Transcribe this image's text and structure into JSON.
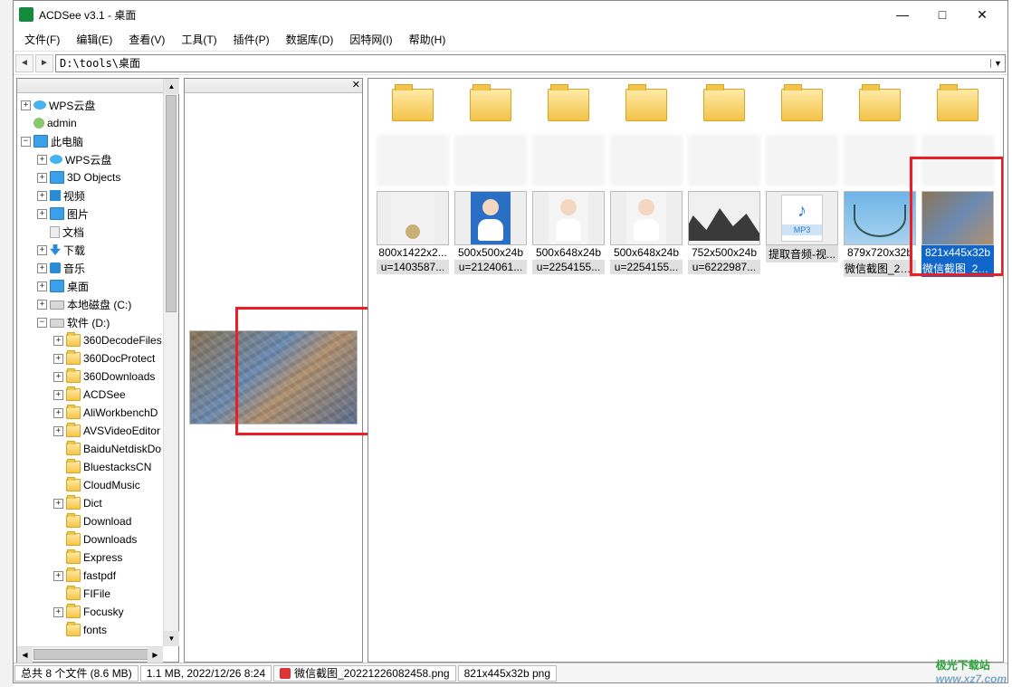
{
  "window": {
    "title": "ACDSee v3.1 - 桌面",
    "min": "—",
    "max": "□",
    "close": "✕"
  },
  "menu": [
    "文件(F)",
    "编辑(E)",
    "查看(V)",
    "工具(T)",
    "插件(P)",
    "数据库(D)",
    "因特网(I)",
    "帮助(H)"
  ],
  "address": "D:\\tools\\桌面",
  "tree": [
    {
      "d": 0,
      "exp": "+",
      "ico": "cloud",
      "label": "WPS云盘"
    },
    {
      "d": 0,
      "exp": "",
      "ico": "user",
      "label": "admin"
    },
    {
      "d": 0,
      "exp": "-",
      "ico": "computer",
      "label": "此电脑"
    },
    {
      "d": 1,
      "exp": "+",
      "ico": "cloud",
      "label": "WPS云盘"
    },
    {
      "d": 1,
      "exp": "+",
      "ico": "computer",
      "label": "3D Objects"
    },
    {
      "d": 1,
      "exp": "+",
      "ico": "video",
      "label": "视频"
    },
    {
      "d": 1,
      "exp": "+",
      "ico": "computer",
      "label": "图片"
    },
    {
      "d": 1,
      "exp": "",
      "ico": "doc",
      "label": "文档"
    },
    {
      "d": 1,
      "exp": "+",
      "ico": "dlarrow",
      "label": "下载"
    },
    {
      "d": 1,
      "exp": "+",
      "ico": "music",
      "label": "音乐"
    },
    {
      "d": 1,
      "exp": "+",
      "ico": "computer",
      "label": "桌面"
    },
    {
      "d": 1,
      "exp": "+",
      "ico": "disk",
      "label": "本地磁盘 (C:)"
    },
    {
      "d": 1,
      "exp": "-",
      "ico": "disk",
      "label": "软件 (D:)"
    },
    {
      "d": 2,
      "exp": "+",
      "ico": "folder",
      "label": "360DecodeFiles"
    },
    {
      "d": 2,
      "exp": "+",
      "ico": "folder",
      "label": "360DocProtect"
    },
    {
      "d": 2,
      "exp": "+",
      "ico": "folder",
      "label": "360Downloads"
    },
    {
      "d": 2,
      "exp": "+",
      "ico": "folder",
      "label": "ACDSee"
    },
    {
      "d": 2,
      "exp": "+",
      "ico": "folder",
      "label": "AliWorkbenchD"
    },
    {
      "d": 2,
      "exp": "+",
      "ico": "folder",
      "label": "AVSVideoEditor"
    },
    {
      "d": 2,
      "exp": "",
      "ico": "folder",
      "label": "BaiduNetdiskDo"
    },
    {
      "d": 2,
      "exp": "",
      "ico": "folder",
      "label": "BluestacksCN"
    },
    {
      "d": 2,
      "exp": "",
      "ico": "folder",
      "label": "CloudMusic"
    },
    {
      "d": 2,
      "exp": "+",
      "ico": "folder",
      "label": "Dict"
    },
    {
      "d": 2,
      "exp": "",
      "ico": "folder",
      "label": "Download"
    },
    {
      "d": 2,
      "exp": "",
      "ico": "folder",
      "label": "Downloads"
    },
    {
      "d": 2,
      "exp": "",
      "ico": "folder",
      "label": "Express"
    },
    {
      "d": 2,
      "exp": "+",
      "ico": "folder",
      "label": "fastpdf"
    },
    {
      "d": 2,
      "exp": "",
      "ico": "folder",
      "label": "FIFile"
    },
    {
      "d": 2,
      "exp": "+",
      "ico": "folder",
      "label": "Focusky"
    },
    {
      "d": 2,
      "exp": "",
      "ico": "folder",
      "label": "fonts"
    }
  ],
  "thumbs_files": [
    {
      "img": "img-tall",
      "dim": "800x1422x2...",
      "name": "u=1403587..."
    },
    {
      "img": "img-portrait",
      "dim": "500x500x24b",
      "name": "u=2124061..."
    },
    {
      "img": "img-portrait white",
      "dim": "500x648x24b",
      "name": "u=2254155..."
    },
    {
      "img": "img-portrait white",
      "dim": "500x648x24b",
      "name": "u=2254155..."
    },
    {
      "img": "img-mountain",
      "dim": "752x500x24b",
      "name": "u=6222987..."
    },
    {
      "img": "img-mp3",
      "dim": "",
      "name": "提取音频-视..."
    },
    {
      "img": "img-bridge",
      "dim": "879x720x32b",
      "name": "微信截图_20..."
    },
    {
      "img": "img-city",
      "dim": "821x445x32b",
      "name": "微信截图_20...",
      "selected": true
    }
  ],
  "status": {
    "total": "总共 8 个文件 (8.6 MB)",
    "sel": "1.1 MB, 2022/12/26 8:24",
    "fname": "微信截图_20221226082458.png",
    "dims": "821x445x32b  png"
  },
  "watermark": {
    "brand": "极光下载站",
    "url": "www.xz7.com"
  }
}
